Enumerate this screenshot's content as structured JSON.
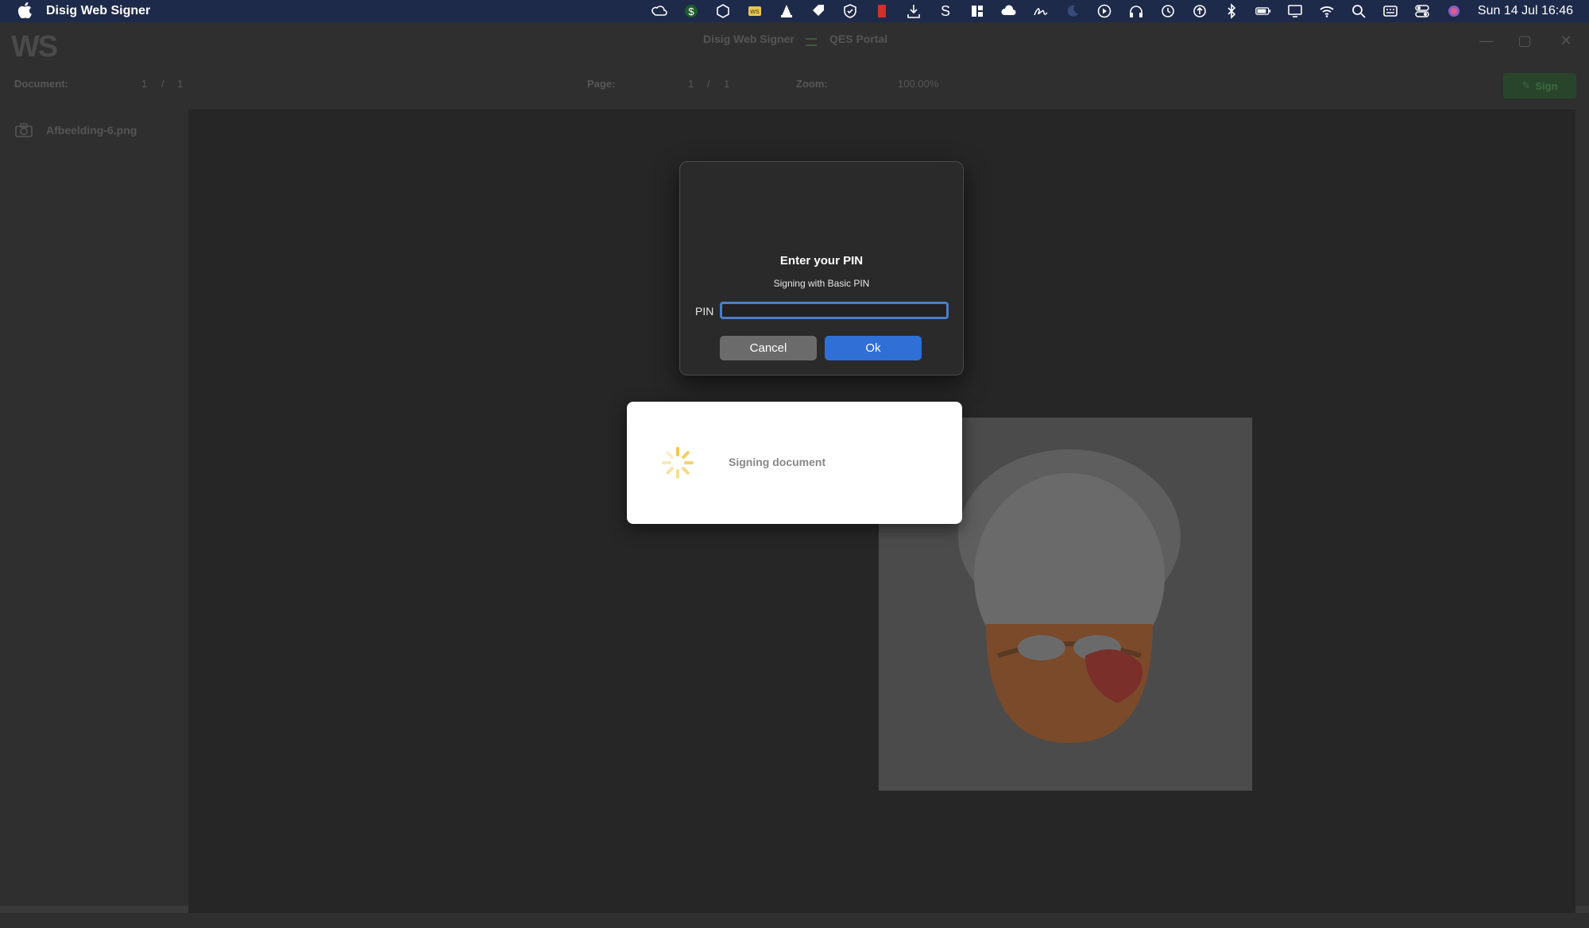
{
  "menubar": {
    "app_name": "Disig Web Signer",
    "clock": "Sun 14 Jul  16:46",
    "icons": [
      "creative-cloud-icon",
      "dollar-icon",
      "box-icon",
      "ws-icon",
      "vlc-icon",
      "tag-icon",
      "shield-icon",
      "bookmark-icon",
      "download-icon",
      "s-icon",
      "grid-icon",
      "cloud-icon",
      "signature-icon",
      "moon-icon",
      "play-icon",
      "headphones-icon",
      "clock-icon",
      "info-icon",
      "bluetooth-icon",
      "battery-icon",
      "display-icon",
      "wifi-icon",
      "search-icon",
      "keyboard-icon",
      "control-center-icon",
      "siri-icon"
    ]
  },
  "window": {
    "logo": "WS",
    "title": "Disig Web Signer",
    "subtitle": "QES Portal"
  },
  "toolbar": {
    "document_label": "Document:",
    "document_current": "1",
    "document_sep": "/",
    "document_total": "1",
    "page_label": "Page:",
    "page_current": "1",
    "page_sep": "/",
    "page_total": "1",
    "zoom_label": "Zoom:",
    "zoom_value": "100.00%",
    "sign_label": "Sign"
  },
  "sidebar": {
    "file_name": "Afbeelding-6.png"
  },
  "pin_dialog": {
    "title": "Enter your PIN",
    "subtitle": "Signing with Basic PIN",
    "pin_label": "PIN",
    "pin_value": "",
    "cancel_label": "Cancel",
    "ok_label": "Ok"
  },
  "signing": {
    "text": "Signing document"
  },
  "colors": {
    "menubar_bg": "#1e2a4a",
    "ok_button": "#2f6fd6",
    "cancel_button": "#6b6b6b",
    "input_focus": "#4a7fc7",
    "spinner": "#f2c94c"
  }
}
